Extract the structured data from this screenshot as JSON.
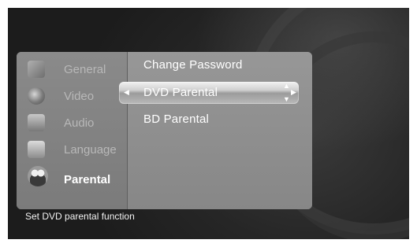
{
  "categories": [
    {
      "label": "General",
      "icon": "general-settings-icon",
      "active": false
    },
    {
      "label": "Video",
      "icon": "video-icon",
      "active": false
    },
    {
      "label": "Audio",
      "icon": "audio-icon",
      "active": false
    },
    {
      "label": "Language",
      "icon": "language-icon",
      "active": false
    },
    {
      "label": "Parental",
      "icon": "parental-icon",
      "active": true
    }
  ],
  "options": [
    {
      "label": "Change Password",
      "selected": false
    },
    {
      "label": "DVD Parental",
      "selected": true
    },
    {
      "label": "BD Parental",
      "selected": false
    }
  ],
  "status_text": "Set DVD parental function",
  "colors": {
    "menu_bg": "#8e8e8e",
    "highlight": "#d8d8d8",
    "inactive_text": "#b8b8b8",
    "active_text": "#ffffff"
  }
}
